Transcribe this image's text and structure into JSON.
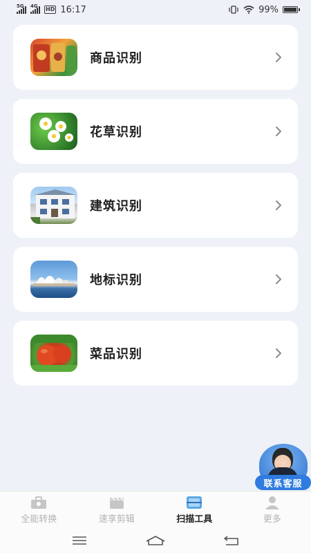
{
  "status_bar": {
    "net1": "5G",
    "net2": "4G",
    "hd": "HD",
    "time": "16:17",
    "battery": "99%"
  },
  "items": [
    {
      "label": "商品识别",
      "image": "goods-image"
    },
    {
      "label": "花草识别",
      "image": "flower-image"
    },
    {
      "label": "建筑识别",
      "image": "building-image"
    },
    {
      "label": "地标识别",
      "image": "landmark-image"
    },
    {
      "label": "菜品识别",
      "image": "dish-image"
    }
  ],
  "customer_service": {
    "label": "联系客服"
  },
  "bottom_nav": [
    {
      "label": "全能转换",
      "icon": "toolbox-icon",
      "active": false
    },
    {
      "label": "速享剪辑",
      "icon": "clapper-icon",
      "active": false
    },
    {
      "label": "扫描工具",
      "icon": "scan-icon",
      "active": true
    },
    {
      "label": "更多",
      "icon": "user-icon",
      "active": false
    }
  ],
  "colors": {
    "background": "#eef1f8",
    "accent": "#2f7be0",
    "active_icon": "#5aa8e6",
    "inactive": "#b3b3b3"
  }
}
